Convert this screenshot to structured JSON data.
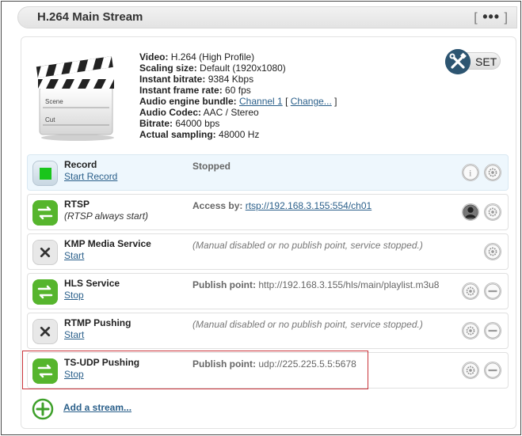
{
  "header": {
    "title": "H.264 Main Stream",
    "menu_open": "[",
    "menu_dots": "•••",
    "menu_close": "]"
  },
  "stream_info": {
    "video_label": "Video:",
    "video_value": "H.264 (High Profile)",
    "scaling_label": "Scaling size:",
    "scaling_value": "Default (1920x1080)",
    "bitrate_label": "Instant bitrate:",
    "bitrate_value": "9384 Kbps",
    "framerate_label": "Instant frame rate:",
    "framerate_value": "60 fps",
    "audio_bundle_label": "Audio engine bundle:",
    "audio_bundle_value": "Channel 1",
    "audio_bundle_change": "Change...",
    "bracket_open": "[",
    "bracket_close": "]",
    "audio_codec_label": "Audio Codec:",
    "audio_codec_value": "AAC / Stereo",
    "audio_bitrate_label": "Bitrate:",
    "audio_bitrate_value": "64000 bps",
    "sampling_label": "Actual sampling:",
    "sampling_value": "48000 Hz"
  },
  "clapper": {
    "line1": "Scene",
    "line2": "Cut"
  },
  "set_button": {
    "label": "SET"
  },
  "services": [
    {
      "name": "Record",
      "action": "Start Record",
      "status_label": "",
      "status_text": "Stopped"
    },
    {
      "name": "RTSP",
      "subtitle": "(RTSP always start)",
      "status_label": "Access by:",
      "status_link": "rtsp://192.168.3.155:554/ch01"
    },
    {
      "name": "KMP Media Service",
      "action": "Start",
      "status_text": "(Manual disabled or no publish point, service stopped.)"
    },
    {
      "name": "HLS Service",
      "action": "Stop",
      "status_label": "Publish point:",
      "status_text": "http://192.168.3.155/hls/main/playlist.m3u8"
    },
    {
      "name": "RTMP Pushing",
      "action": "Start",
      "status_text": "(Manual disabled or no publish point, service stopped.)"
    },
    {
      "name": "TS-UDP Pushing",
      "action": "Stop",
      "status_label": "Publish point:",
      "status_text": "udp://225.225.5.5:5678"
    }
  ],
  "add_stream": {
    "label": "Add a stream..."
  },
  "colors": {
    "accent_link": "#2a5f8a",
    "green_icon": "#4caf25",
    "highlight_border": "#c9333a",
    "set_icon": "#2d5571"
  }
}
